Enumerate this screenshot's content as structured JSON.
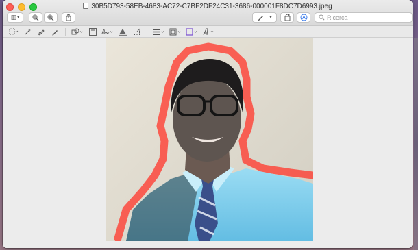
{
  "window": {
    "title": "30B5D793-58EB-4683-AC72-C7BF2DF24C31-3686-000001F8DC7D6993.jpeg"
  },
  "toolbar": {
    "sidebar_icon": "sidebar-icon",
    "zoom_out_icon": "zoom-out-icon",
    "zoom_in_icon": "zoom-in-icon",
    "share_icon": "share-icon",
    "pen_icon": "pen-icon",
    "rotate_icon": "rotate-icon",
    "markup_icon": "markup-icon",
    "search_placeholder": "Ricerca"
  },
  "markup_tools": [
    "selection-icon",
    "instant-alpha-icon",
    "sketch-icon",
    "draw-icon",
    "shapes-icon",
    "text-icon",
    "sign-icon",
    "adjust-color-icon",
    "crop-icon",
    "line-style-icon",
    "border-color-icon",
    "fill-color-icon",
    "text-style-icon"
  ],
  "colors": {
    "highlight": "#ff3b30",
    "shirt": "#7fd0ee",
    "tie": "#3a4f8a"
  }
}
